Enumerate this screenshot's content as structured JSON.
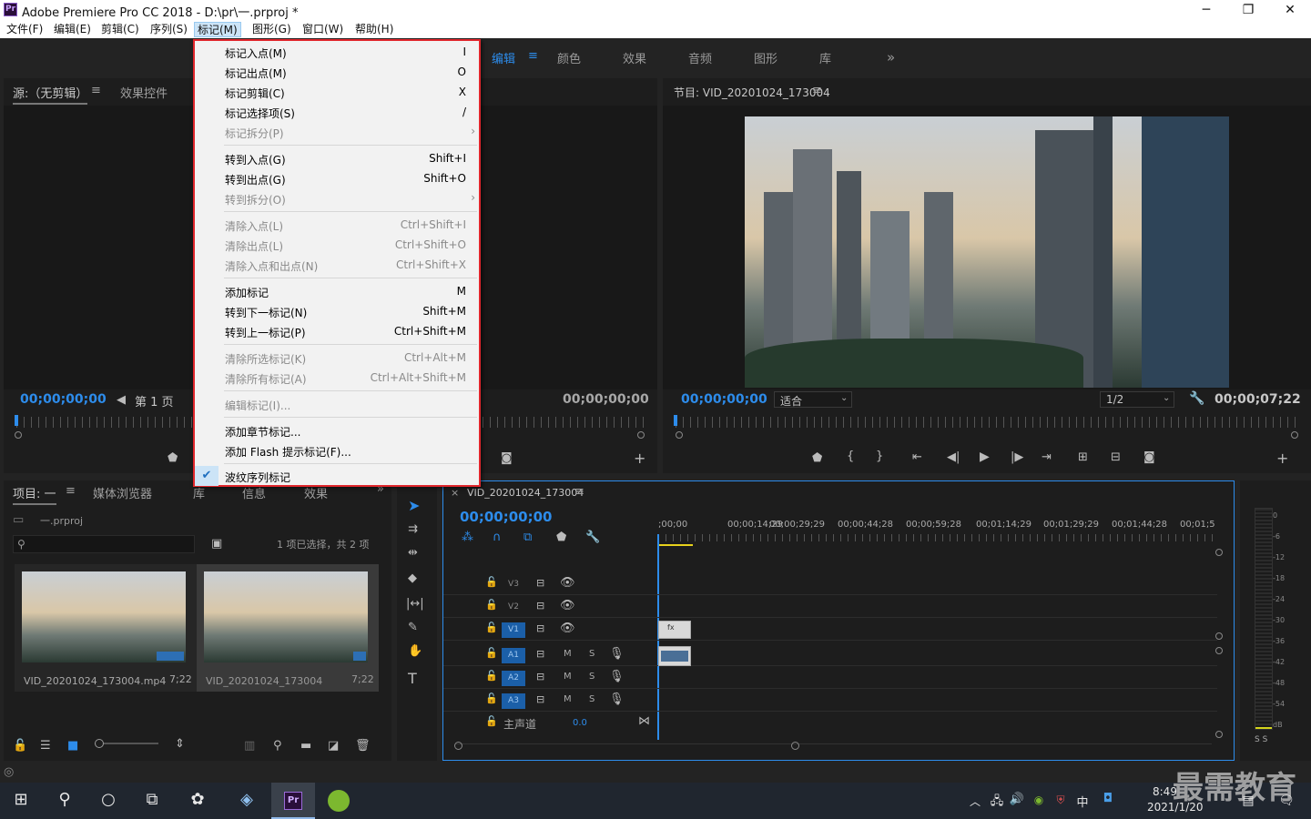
{
  "title_bar": {
    "logo": "Pr",
    "title": "Adobe Premiere Pro CC 2018 - D:\\pr\\一.prproj *",
    "minimize": "─",
    "maximize": "❐",
    "close": "✕"
  },
  "menu": [
    "文件(F)",
    "编辑(E)",
    "剪辑(C)",
    "序列(S)",
    "标记(M)",
    "图形(G)",
    "窗口(W)",
    "帮助(H)"
  ],
  "workspaces": [
    "编辑",
    "颜色",
    "效果",
    "音频",
    "图形",
    "库"
  ],
  "workspace_more": "»",
  "source_panel": {
    "tab": "源:（无剪辑）",
    "tab2": "效果控件",
    "timecode_in": "00;00;00;00",
    "page": "第 1 页",
    "timecode_out": "00;00;00;00"
  },
  "program_panel": {
    "title": "节目: VID_20201024_173004",
    "timecode": "00;00;00;00",
    "fit": "适合",
    "quality": "1/2",
    "duration": "00;00;07;22"
  },
  "project_panel": {
    "tabs": [
      "项目: 一",
      "媒体浏览器",
      "库",
      "信息",
      "效果"
    ],
    "file": "一.prproj",
    "selection": "1 项已选择，共 2 项",
    "items": [
      {
        "name": "VID_20201024_173004.mp4",
        "duration": "7;22"
      },
      {
        "name": "VID_20201024_173004",
        "duration": "7;22"
      }
    ]
  },
  "timeline": {
    "tab": "VID_20201024_173004",
    "timecode": "00;00;00;00",
    "ruler": [
      ";00;00",
      "00;00;14;29",
      "00;00;29;29",
      "00;00;44;28",
      "00;00;59;28",
      "00;01;14;29",
      "00;01;29;29",
      "00;01;44;28",
      "00;01;5"
    ],
    "video_tracks": [
      "V3",
      "V2",
      "V1"
    ],
    "audio_tracks": [
      "A1",
      "A2",
      "A3"
    ],
    "mute": "M",
    "solo": "S",
    "master": "主声道",
    "master_value": "0.0"
  },
  "audio_meter": {
    "scale": [
      "0",
      "-6",
      "-12",
      "-18",
      "-24",
      "-30",
      "-36",
      "-42",
      "-48",
      "-54",
      "dB"
    ],
    "solo": "S S"
  },
  "dropdown": {
    "items": [
      {
        "label": "标记入点(M)",
        "shortcut": "I",
        "enabled": true
      },
      {
        "label": "标记出点(M)",
        "shortcut": "O",
        "enabled": true
      },
      {
        "label": "标记剪辑(C)",
        "shortcut": "X",
        "enabled": true
      },
      {
        "label": "标记选择项(S)",
        "shortcut": "/",
        "enabled": true
      },
      {
        "label": "标记拆分(P)",
        "shortcut": "",
        "enabled": false,
        "submenu": true
      },
      {
        "label": "转到入点(G)",
        "shortcut": "Shift+I",
        "enabled": true
      },
      {
        "label": "转到出点(G)",
        "shortcut": "Shift+O",
        "enabled": true
      },
      {
        "label": "转到拆分(O)",
        "shortcut": "",
        "enabled": false,
        "submenu": true
      },
      {
        "label": "清除入点(L)",
        "shortcut": "Ctrl+Shift+I",
        "enabled": false
      },
      {
        "label": "清除出点(L)",
        "shortcut": "Ctrl+Shift+O",
        "enabled": false
      },
      {
        "label": "清除入点和出点(N)",
        "shortcut": "Ctrl+Shift+X",
        "enabled": false
      },
      {
        "label": "添加标记",
        "shortcut": "M",
        "enabled": true
      },
      {
        "label": "转到下一标记(N)",
        "shortcut": "Shift+M",
        "enabled": true
      },
      {
        "label": "转到上一标记(P)",
        "shortcut": "Ctrl+Shift+M",
        "enabled": true
      },
      {
        "label": "清除所选标记(K)",
        "shortcut": "Ctrl+Alt+M",
        "enabled": false
      },
      {
        "label": "清除所有标记(A)",
        "shortcut": "Ctrl+Alt+Shift+M",
        "enabled": false
      },
      {
        "label": "编辑标记(I)...",
        "shortcut": "",
        "enabled": false
      },
      {
        "label": "添加章节标记...",
        "shortcut": "",
        "enabled": true
      },
      {
        "label": "添加 Flash 提示标记(F)...",
        "shortcut": "",
        "enabled": true
      },
      {
        "label": "波纹序列标记",
        "shortcut": "",
        "enabled": true,
        "checked": true
      }
    ]
  },
  "taskbar": {
    "time": "8:49",
    "date": "2021/1/20",
    "ime": "中",
    "watermark": "最需教育"
  },
  "colors": {
    "accent": "#2d8ceb",
    "highlight_border": "#e0262c",
    "track_on": "#1b5fa8"
  }
}
